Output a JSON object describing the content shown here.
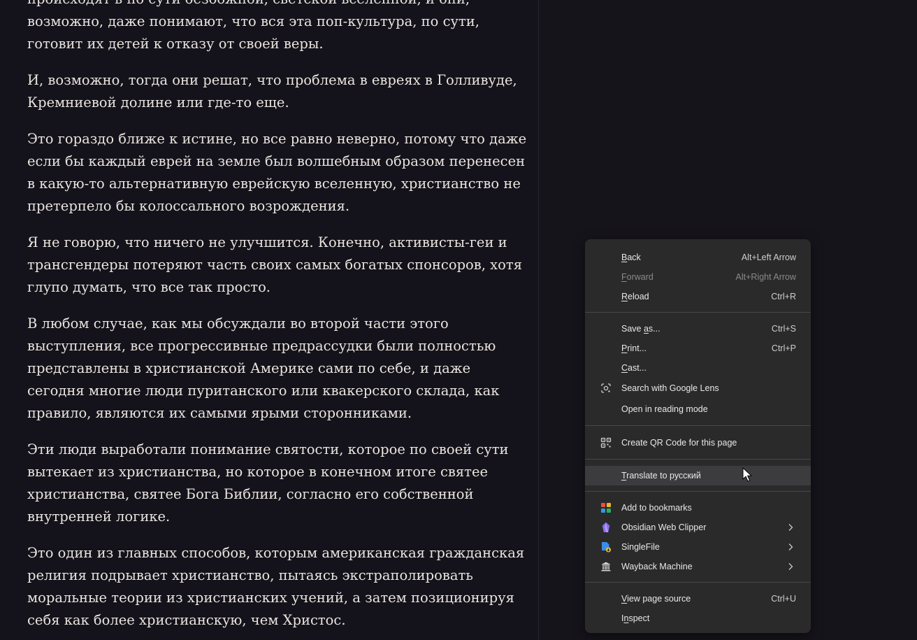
{
  "article": {
    "paragraphs": [
      "происходят в по сути безбожной, светской вселенной, и они, возможно, даже понимают, что вся эта поп-культура, по сути, готовит их детей к отказу от своей веры.",
      "И, возможно, тогда они решат, что проблема в евреях в Голливуде, Кремниевой долине или где-то еще.",
      "Это гораздо ближе к истине, но все равно неверно, потому что даже если бы каждый еврей на земле был волшебным образом перенесен в какую-то альтернативную еврейскую вселенную, христианство не претерпело бы колоссального возрождения.",
      "Я не говорю, что ничего не улучшится. Конечно, активисты-геи и трансгендеры потеряют часть своих самых богатых спонсоров, хотя глупо думать, что все так просто.",
      "В любом случае, как мы обсуждали во второй части этого выступления, все прогрессивные предрассудки были полностью представлены в христианской Америке сами по себе, и даже сегодня многие люди пуританского или квакерского склада, как правило, являются их самыми ярыми сторонниками.",
      "Эти люди выработали понимание святости, которое по своей сути вытекает из христианства, но которое в конечном итоге святее христианства, святее Бога Библии, согласно его собственной внутренней логике.",
      "Это один из главных способов, которым американская гражданская религия подрывает христианство, пытаясь экстраполировать моральные теории из христианских учений, а затем позиционируя себя как более христианскую, чем Христос."
    ]
  },
  "menu": {
    "back": {
      "pre": "",
      "key": "B",
      "post": "ack",
      "shortcut": "Alt+Left Arrow"
    },
    "forward": {
      "pre": "",
      "key": "F",
      "post": "orward",
      "shortcut": "Alt+Right Arrow"
    },
    "reload": {
      "pre": "",
      "key": "R",
      "post": "eload",
      "shortcut": "Ctrl+R"
    },
    "save_as": {
      "pre": "Save ",
      "key": "a",
      "post": "s...",
      "shortcut": "Ctrl+S"
    },
    "print": {
      "pre": "",
      "key": "P",
      "post": "rint...",
      "shortcut": "Ctrl+P"
    },
    "cast": {
      "pre": "",
      "key": "C",
      "post": "ast...",
      "shortcut": ""
    },
    "google_lens": {
      "label": "Search with Google Lens",
      "icon": "google-lens-icon"
    },
    "reading_mode": {
      "label": "Open in reading mode"
    },
    "qr_code": {
      "label": "Create QR Code for this page",
      "icon": "qr-code-icon"
    },
    "translate": {
      "pre": "",
      "key": "T",
      "post": "ranslate to русский"
    },
    "bookmarks": {
      "label": "Add to bookmarks",
      "icon": "bookmark-extension-icon"
    },
    "obsidian": {
      "label": "Obsidian Web Clipper",
      "icon": "obsidian-icon"
    },
    "singlefile": {
      "label": "SingleFile",
      "icon": "singlefile-icon"
    },
    "wayback": {
      "label": "Wayback Machine",
      "icon": "wayback-machine-icon"
    },
    "view_source": {
      "pre": "",
      "key": "V",
      "post": "iew page source",
      "shortcut": "Ctrl+U"
    },
    "inspect": {
      "pre": "I",
      "key": "n",
      "post": "spect"
    }
  },
  "colors": {
    "background": "#14121a",
    "text": "#e9e5df",
    "menu_bg": "#2a2a2b",
    "menu_hover": "#3c3c3e"
  }
}
